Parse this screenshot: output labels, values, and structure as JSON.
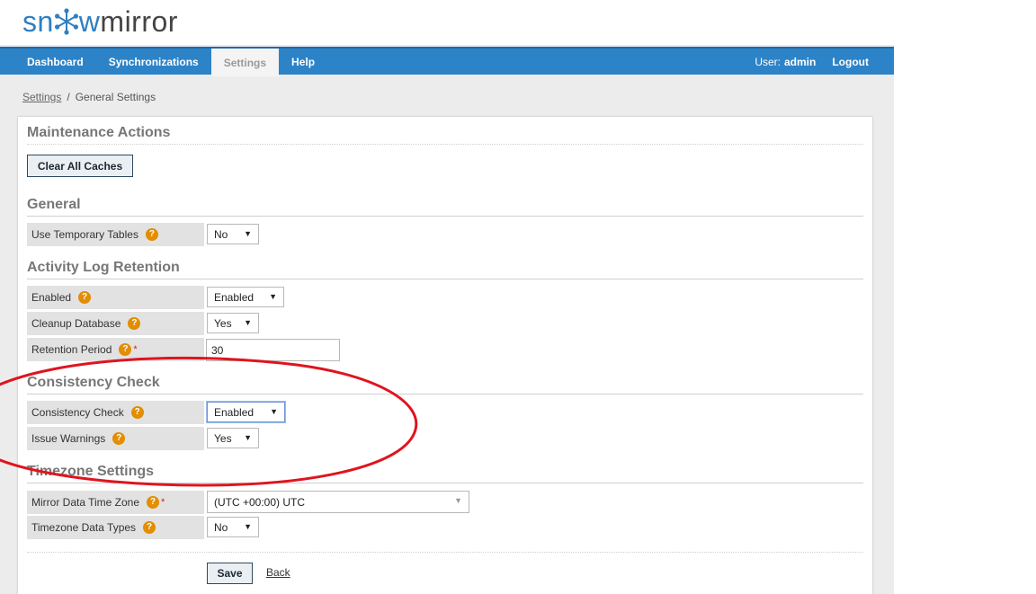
{
  "logo": {
    "part1": "sn",
    "part2": "w",
    "part3": "mirror"
  },
  "nav": {
    "items": [
      {
        "label": "Dashboard"
      },
      {
        "label": "Synchronizations"
      },
      {
        "label": "Settings"
      },
      {
        "label": "Help"
      }
    ],
    "user_prefix": "User:",
    "user_name": "admin",
    "logout": "Logout"
  },
  "breadcrumb": {
    "parent": "Settings",
    "separator": "/",
    "current": "General Settings"
  },
  "sections": {
    "maintenance": {
      "title": "Maintenance Actions",
      "clear_caches": "Clear All Caches"
    },
    "general": {
      "title": "General",
      "use_temp_tables": {
        "label": "Use Temporary Tables",
        "value": "No"
      }
    },
    "activity_log": {
      "title": "Activity Log Retention",
      "enabled": {
        "label": "Enabled",
        "value": "Enabled"
      },
      "cleanup": {
        "label": "Cleanup Database",
        "value": "Yes"
      },
      "retention": {
        "label": "Retention Period",
        "required": "*",
        "value": "30"
      }
    },
    "consistency": {
      "title": "Consistency Check",
      "check": {
        "label": "Consistency Check",
        "value": "Enabled"
      },
      "warnings": {
        "label": "Issue Warnings",
        "value": "Yes"
      }
    },
    "timezone": {
      "title": "Timezone Settings",
      "mirror_tz": {
        "label": "Mirror Data Time Zone",
        "required": "*",
        "value": "(UTC +00:00) UTC"
      },
      "tz_types": {
        "label": "Timezone Data Types",
        "value": "No"
      }
    }
  },
  "footer": {
    "save": "Save",
    "back": "Back"
  },
  "help_glyph": "?",
  "caret_glyph": "▼",
  "colors": {
    "nav": "#2d83c8",
    "brand": "#2f7fc1",
    "help": "#e38d00",
    "annotation": "#e0141e"
  }
}
